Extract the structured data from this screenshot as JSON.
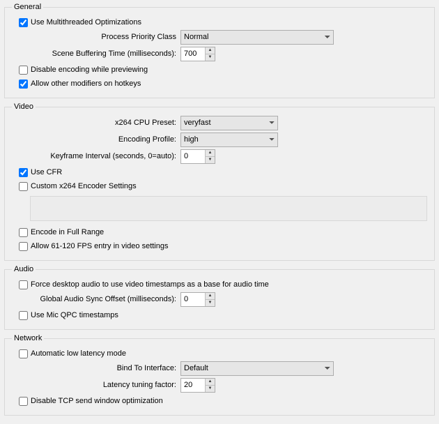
{
  "general": {
    "legend": "General",
    "use_multithreaded_label": "Use Multithreaded Optimizations",
    "use_multithreaded_checked": true,
    "priority_class_label": "Process Priority Class",
    "priority_class_value": "Normal",
    "scene_buffer_label": "Scene Buffering Time (milliseconds):",
    "scene_buffer_value": "700",
    "disable_encoding_label": "Disable encoding while previewing",
    "disable_encoding_checked": false,
    "allow_modifiers_label": "Allow other modifiers on hotkeys",
    "allow_modifiers_checked": true
  },
  "video": {
    "legend": "Video",
    "cpu_preset_label": "x264 CPU Preset:",
    "cpu_preset_value": "veryfast",
    "encoding_profile_label": "Encoding Profile:",
    "encoding_profile_value": "high",
    "keyframe_label": "Keyframe Interval (seconds, 0=auto):",
    "keyframe_value": "0",
    "use_cfr_label": "Use CFR",
    "use_cfr_checked": true,
    "custom_x264_label": "Custom x264 Encoder Settings",
    "custom_x264_checked": false,
    "encode_full_range_label": "Encode in Full Range",
    "encode_full_range_checked": false,
    "allow_fps_label": "Allow 61-120 FPS entry in video settings",
    "allow_fps_checked": false
  },
  "audio": {
    "legend": "Audio",
    "force_desktop_label": "Force desktop audio to use video timestamps as a base for audio time",
    "force_desktop_checked": false,
    "global_offset_label": "Global Audio Sync Offset (milliseconds):",
    "global_offset_value": "0",
    "use_mic_qpc_label": "Use Mic QPC timestamps",
    "use_mic_qpc_checked": false
  },
  "network": {
    "legend": "Network",
    "auto_low_latency_label": "Automatic low latency mode",
    "auto_low_latency_checked": false,
    "bind_interface_label": "Bind To Interface:",
    "bind_interface_value": "Default",
    "latency_factor_label": "Latency tuning factor:",
    "latency_factor_value": "20",
    "disable_tcp_label": "Disable TCP send window optimization",
    "disable_tcp_checked": false
  }
}
